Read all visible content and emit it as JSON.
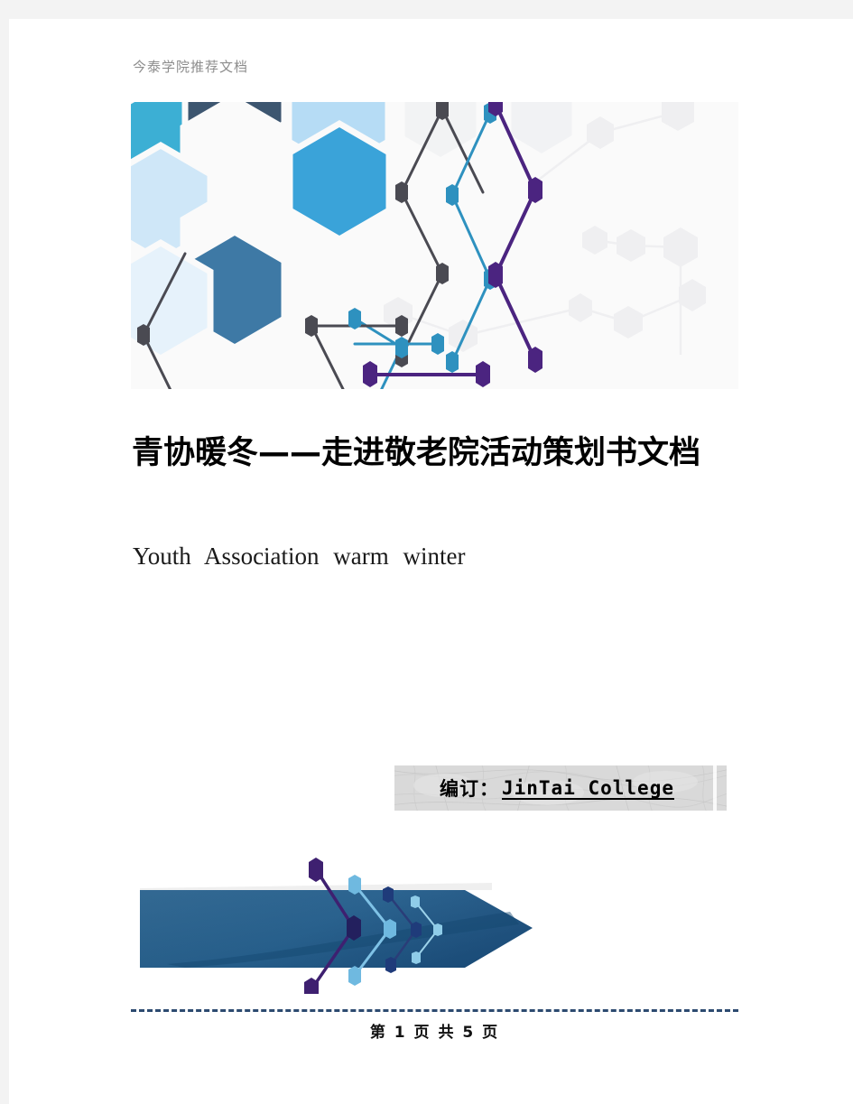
{
  "header": {
    "running_head": "今泰学院推荐文档"
  },
  "banner": {
    "name": "hexagon-network-banner",
    "palette": {
      "teal": "#3CAFD4",
      "slate_dark": "#3D5670",
      "light_blue": "#B6DCF5",
      "mid_blue": "#3AA3D9",
      "steel_blue": "#3E79A5",
      "pale_blue": "#CFE7F8",
      "node_dark": "#4A4A52",
      "node_purple": "#5B2D8E",
      "node_teal": "#2E91BF",
      "ghost": "#F0F0F2",
      "background": "#FAFAFA"
    }
  },
  "title": {
    "text": "青协暖冬——走进敬老院活动策划书文档"
  },
  "subtitle": {
    "text": "Youth Association  warm  winter"
  },
  "signature": {
    "prefix": "编订：",
    "latin": "JinTai  College"
  },
  "footer_graphic": {
    "name": "blue-arrow-chevrons",
    "palette": {
      "arrow_blue": "#1E5B8C",
      "arrow_shade": "#174D79",
      "chevron_purple": "#4B2480",
      "chevron_light_blue": "#6FB9E0",
      "chevron_navy": "#1F3B7A",
      "chevron_pale": "#8FCCE8"
    }
  },
  "footer": {
    "page_label": "第 1 页 共 5 页",
    "rule_color": "#2c4a70"
  }
}
